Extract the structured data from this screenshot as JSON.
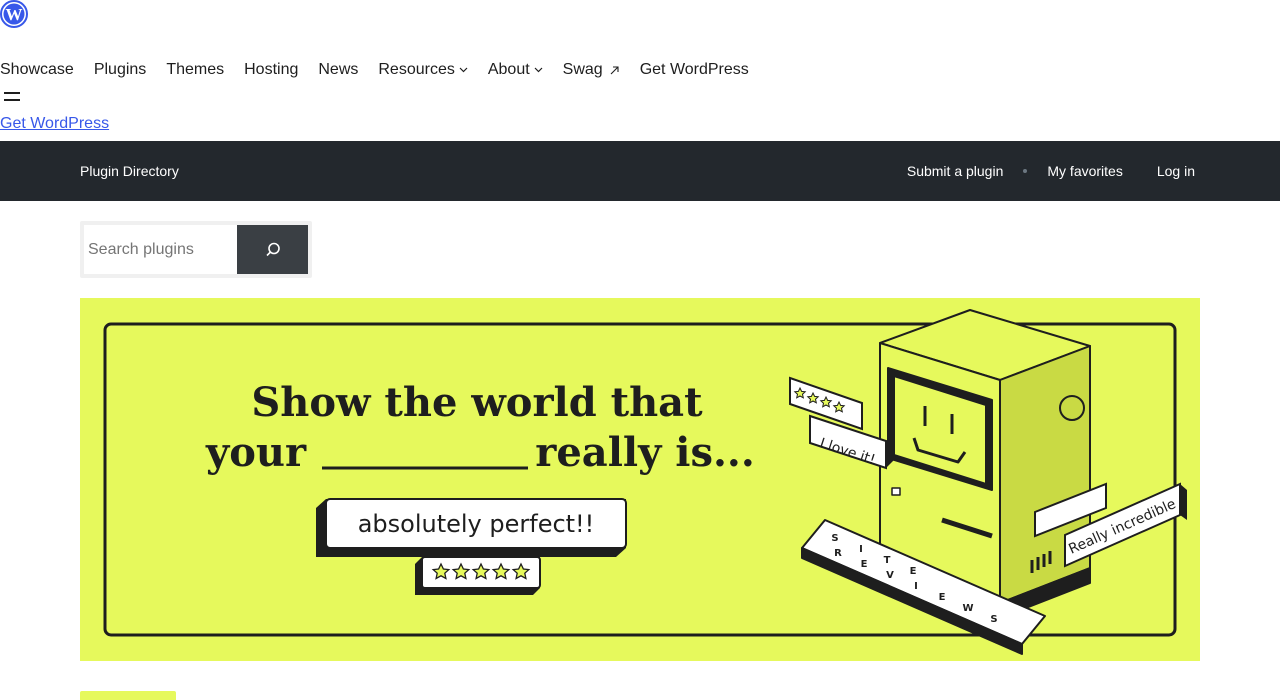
{
  "global_nav": {
    "items": [
      {
        "label": "Showcase"
      },
      {
        "label": "Plugins"
      },
      {
        "label": "Themes"
      },
      {
        "label": "Hosting"
      },
      {
        "label": "News"
      },
      {
        "label": "Resources",
        "has_dropdown": true
      },
      {
        "label": "About",
        "has_dropdown": true
      },
      {
        "label": "Swag",
        "external": true
      },
      {
        "label": "Get WordPress"
      }
    ],
    "get_wordpress_link": "Get WordPress"
  },
  "local_nav": {
    "title": "Plugin Directory",
    "submit": "Submit a plugin",
    "favorites": "My favorites",
    "login": "Log in"
  },
  "search": {
    "placeholder": "Search plugins"
  },
  "banner": {
    "headline_line1": "Show the world that",
    "headline_line2_start": "your",
    "headline_line2_end": "really is...",
    "tag_perfect": "absolutely perfect!!",
    "tag_love": "I love it!",
    "tag_incredible": "Really incredible",
    "keyboard_letters": [
      "S",
      "I",
      "T",
      "E",
      "R",
      "E",
      "V",
      "I",
      "E",
      "W",
      "S"
    ]
  },
  "colors": {
    "banner_bg": "#e6f95c",
    "local_nav_bg": "#23282d",
    "link": "#3858e9"
  }
}
